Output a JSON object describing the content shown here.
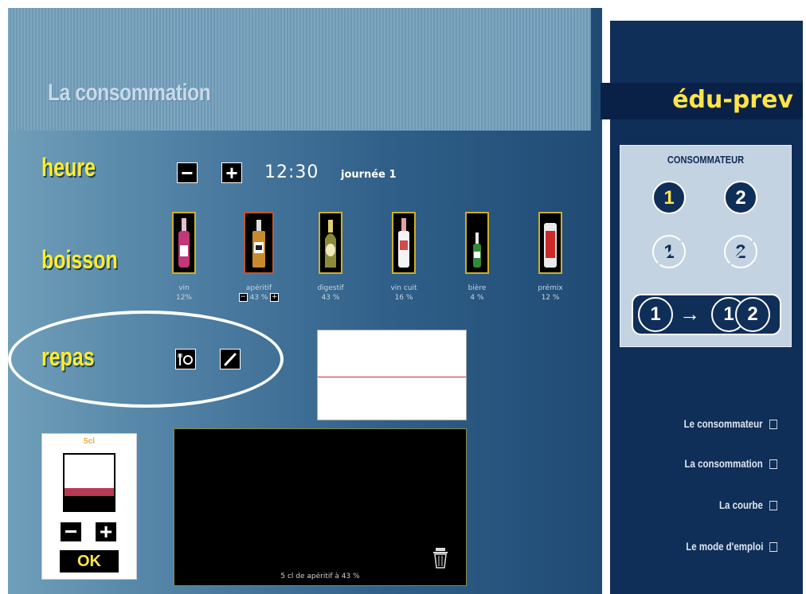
{
  "app_title": "La consommation",
  "brand": "édu-prev",
  "time_section": {
    "label": "heure",
    "minus": "−",
    "plus": "+",
    "time": "12:30",
    "day": "journée 1"
  },
  "drink_section": {
    "label": "boisson",
    "drinks": [
      {
        "name": "vin",
        "percent": "12%"
      },
      {
        "name": "apéritif",
        "percent": "43 %",
        "selected": true
      },
      {
        "name": "digestif",
        "percent": "43 %"
      },
      {
        "name": "vin cuit",
        "percent": "16 %"
      },
      {
        "name": "bière",
        "percent": "4 %"
      },
      {
        "name": "prémix",
        "percent": "12 %"
      }
    ]
  },
  "meal_section": {
    "label": "repas"
  },
  "glass_panel": {
    "volume_label": "5cl",
    "minus": "−",
    "plus": "+",
    "ok": "OK"
  },
  "log": {
    "entry": "5 cl de apéritif à 43 %"
  },
  "consumer_panel": {
    "title": "CONSOMMATEUR",
    "c1": "1",
    "c2": "2",
    "combo": [
      "1",
      "→",
      "1",
      "2"
    ]
  },
  "nav": {
    "items": [
      "Le consommateur",
      "La consommation",
      "La courbe",
      "Le mode d'emploi"
    ]
  },
  "colors": {
    "accent": "#ffee2a",
    "panel_dark": "#0f2e58",
    "brand": "#ffe44a"
  }
}
